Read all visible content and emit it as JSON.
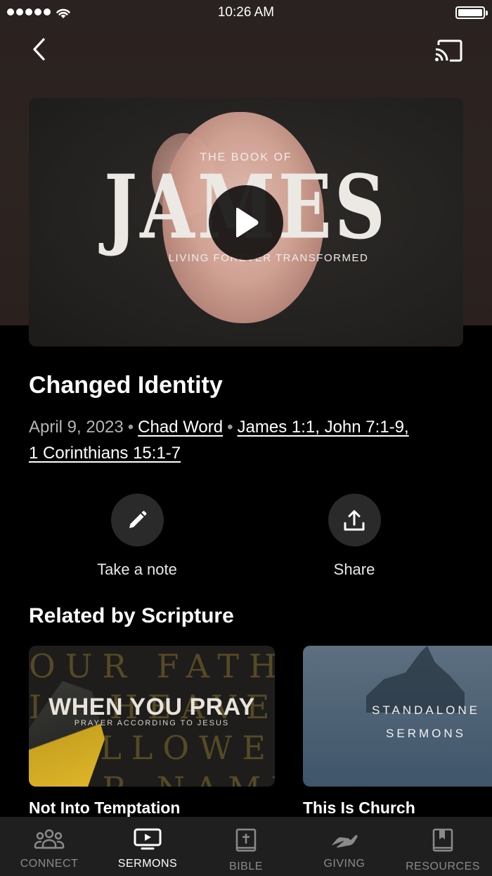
{
  "status_bar": {
    "time": "10:26 AM"
  },
  "hero": {
    "overline": "THE BOOK OF",
    "title": "JAMES",
    "subline": "LIVING FOREVER TRANSFORMED"
  },
  "sermon": {
    "title": "Changed Identity",
    "date": "April 9, 2023",
    "speaker": "Chad Word",
    "scripture_line1": "James 1:1, John 7:1-9,",
    "scripture_line2": "1 Corinthians 15:1-7",
    "separator": "•"
  },
  "actions": {
    "note_label": "Take a note",
    "share_label": "Share"
  },
  "related": {
    "section_title": "Related by Scripture",
    "cards": [
      {
        "art_title": "WHEN YOU PRAY",
        "art_subtitle": "PRAYER ACCORDING TO JESUS",
        "art_background": [
          "OUR FATHER",
          "IN HEAVEN",
          "HALLOWED B",
          "OUR NAME"
        ],
        "caption": "Not Into Temptation"
      },
      {
        "art_title_line1": "STANDALONE",
        "art_title_line2": "SERMONS",
        "caption": "This Is Church"
      }
    ]
  },
  "tabs": [
    {
      "label": "CONNECT",
      "icon": "people-icon",
      "active": false
    },
    {
      "label": "SERMONS",
      "icon": "tv-play-icon",
      "active": true
    },
    {
      "label": "BIBLE",
      "icon": "bible-icon",
      "active": false
    },
    {
      "label": "GIVING",
      "icon": "giving-hand-icon",
      "active": false
    },
    {
      "label": "RESOURCES",
      "icon": "bookmark-book-icon",
      "active": false
    }
  ],
  "colors": {
    "background": "#000000",
    "header_background": "#2b2220",
    "tab_bar": "#1f1f1f",
    "active_tab": "#ffffff",
    "inactive_tab": "#8a8a8a",
    "meta_text": "#b5b5b5"
  }
}
